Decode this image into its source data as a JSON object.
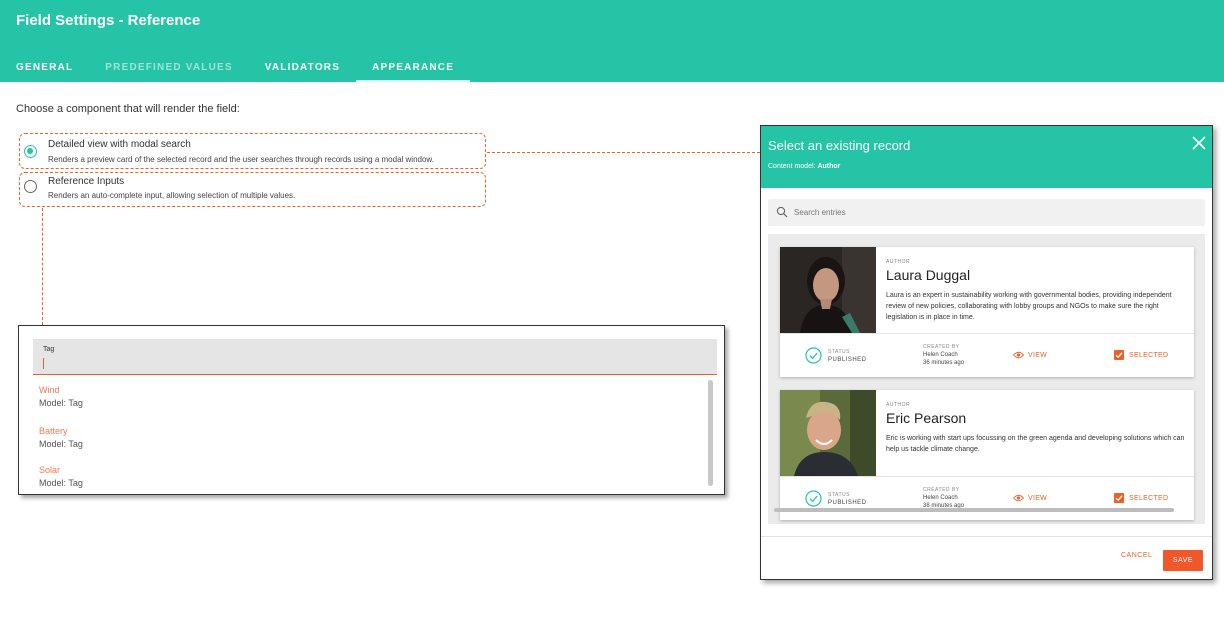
{
  "header": {
    "title": "Field Settings - Reference",
    "tabs": [
      {
        "label": "GENERAL"
      },
      {
        "label": "PREDEFINED VALUES"
      },
      {
        "label": "VALIDATORS"
      },
      {
        "label": "APPEARANCE"
      }
    ]
  },
  "prompt": "Choose a component that will render the field:",
  "options": [
    {
      "title": "Detailed view with modal search",
      "description": "Renders a preview card of the selected record and the user searches through records using a modal window.",
      "selected": true
    },
    {
      "title": "Reference Inputs",
      "description": "Renders an auto-complete input, allowing selection of multiple values.",
      "selected": false
    }
  ],
  "tag_input": {
    "label": "Tag",
    "items": [
      {
        "name": "Wind",
        "model": "Model: Tag"
      },
      {
        "name": "Battery",
        "model": "Model: Tag"
      },
      {
        "name": "Solar",
        "model": "Model: Tag"
      }
    ]
  },
  "modal": {
    "title": "Select an existing record",
    "subtitle_prefix": "Content model:",
    "subtitle_model": "Author",
    "search_placeholder": "Search entries",
    "cards": [
      {
        "kind": "AUTHOR",
        "name": "Laura Duggal",
        "description": "Laura is an expert in sustainability working with governmental bodies, providing independent review of new policies, collaborating with lobby groups and NGOs to make sure the right legislation is in place in time.",
        "status_label": "STATUS",
        "status_value": "PUBLISHED",
        "created_label": "CREATED BY",
        "created_by": "Helen Coach",
        "created_when": "36 minutes ago",
        "view_label": "VIEW",
        "selected_label": "SELECTED"
      },
      {
        "kind": "AUTHOR",
        "name": "Eric Pearson",
        "description": "Eric is working with start ups focussing on the green agenda and developing solutions which can help us tackle climate change.",
        "status_label": "STATUS",
        "status_value": "PUBLISHED",
        "created_label": "CREATED BY",
        "created_by": "Helen Coach",
        "created_when": "38 minutes ago",
        "view_label": "VIEW",
        "selected_label": "SELECTED"
      }
    ],
    "cancel_label": "CANCEL",
    "save_label": "SAVE"
  },
  "colors": {
    "brand": "#25c4a6",
    "accent": "#e8622a",
    "save": "#f0572a"
  }
}
